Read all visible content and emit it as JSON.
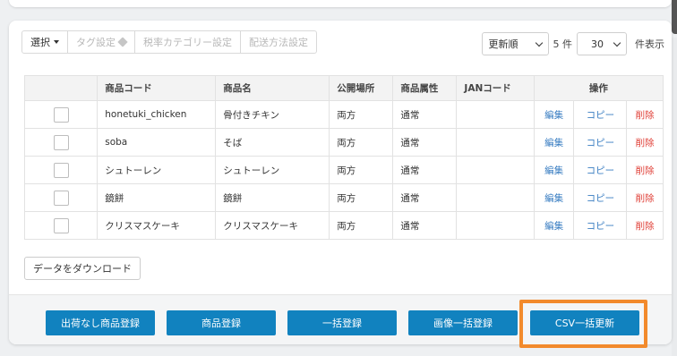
{
  "toolbar": {
    "select_label": "選択",
    "tag_settings_label": "タグ設定",
    "tax_category_label": "税率カテゴリー設定",
    "shipping_label": "配送方法設定"
  },
  "sort": {
    "order_label": "更新順",
    "count_label": "5 件",
    "per_page_value": "30",
    "per_page_suffix": "件表示"
  },
  "table": {
    "headers": {
      "code": "商品コード",
      "name": "商品名",
      "location": "公開場所",
      "attribute": "商品属性",
      "jan": "JANコード",
      "actions": "操作"
    },
    "rows": [
      {
        "code": "honetuki_chicken",
        "name": "骨付きチキン",
        "location": "両方",
        "attribute": "通常",
        "jan": "",
        "edit": "編集",
        "copy": "コピー",
        "delete": "削除"
      },
      {
        "code": "soba",
        "name": "そば",
        "location": "両方",
        "attribute": "通常",
        "jan": "",
        "edit": "編集",
        "copy": "コピー",
        "delete": "削除"
      },
      {
        "code": "シュトーレン",
        "name": "シュトーレン",
        "location": "両方",
        "attribute": "通常",
        "jan": "",
        "edit": "編集",
        "copy": "コピー",
        "delete": "削除"
      },
      {
        "code": "鏡餅",
        "name": "鏡餅",
        "location": "両方",
        "attribute": "通常",
        "jan": "",
        "edit": "編集",
        "copy": "コピー",
        "delete": "削除"
      },
      {
        "code": "クリスマスケーキ",
        "name": "クリスマスケーキ",
        "location": "両方",
        "attribute": "通常",
        "jan": "",
        "edit": "編集",
        "copy": "コピー",
        "delete": "削除"
      }
    ]
  },
  "download_label": "データをダウンロード",
  "footer": {
    "no_shipping_label": "出荷なし商品登録",
    "register_label": "商品登録",
    "bulk_label": "一括登録",
    "image_bulk_label": "画像一括登録",
    "csv_label": "CSV一括更新"
  },
  "colors": {
    "primary": "#1182bf",
    "highlight": "#f28a2c",
    "link": "#3a7ec2",
    "danger": "#e0423a"
  }
}
